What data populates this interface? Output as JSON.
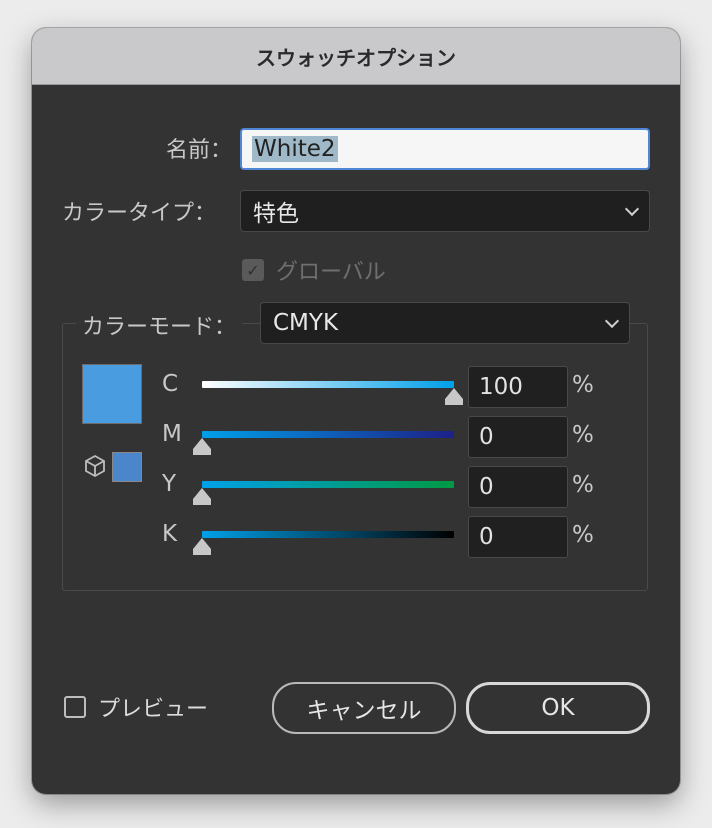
{
  "dialog": {
    "title": "スウォッチオプション"
  },
  "form": {
    "name_label": "名前：",
    "name_value": "White2",
    "color_type_label": "カラータイプ：",
    "color_type_value": "特色",
    "global_label": "グローバル",
    "global_checked": true,
    "color_mode_label": "カラーモード：",
    "color_mode_value": "CMYK"
  },
  "swatch": {
    "current_color": "#4a9ce0",
    "gamut_color": "#4b86cc"
  },
  "sliders": [
    {
      "channel": "C",
      "value": "100",
      "unit": "%",
      "fraction": 1.0,
      "gradient": [
        "#ffffff",
        "#00a0e9"
      ]
    },
    {
      "channel": "M",
      "value": "0",
      "unit": "%",
      "fraction": 0.0,
      "gradient": [
        "#00a0e9",
        "#1d2088"
      ]
    },
    {
      "channel": "Y",
      "value": "0",
      "unit": "%",
      "fraction": 0.0,
      "gradient": [
        "#00a0e9",
        "#009944"
      ]
    },
    {
      "channel": "K",
      "value": "0",
      "unit": "%",
      "fraction": 0.0,
      "gradient": [
        "#00a0e9",
        "#000000"
      ]
    }
  ],
  "footer": {
    "preview_label": "プレビュー",
    "preview_checked": false,
    "cancel_label": "キャンセル",
    "ok_label": "OK"
  }
}
